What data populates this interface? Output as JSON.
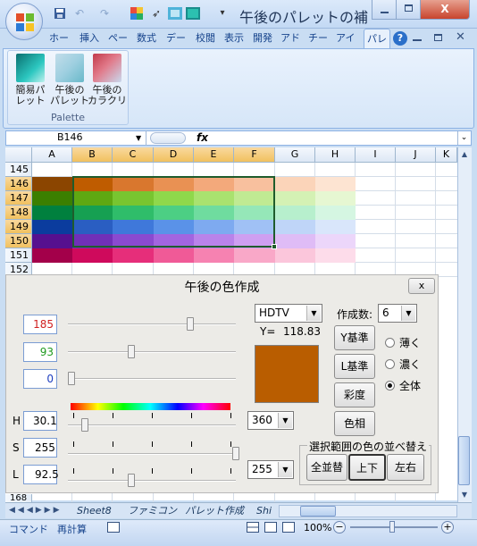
{
  "titlebar": {
    "title": "午後のパレットの補",
    "close": "X",
    "qa_icons": [
      "save-icon",
      "undo-icon",
      "redo-icon",
      "color-grid-icon",
      "pointer-icon",
      "palette-icon"
    ]
  },
  "ribbon": {
    "tabs": [
      "ホー",
      "挿入",
      "ペー",
      "数式",
      "デー",
      "校閲",
      "表示",
      "開発",
      "アド",
      "チー",
      "アイ",
      "パレ"
    ],
    "active_tab": "パレ",
    "buttons": [
      {
        "label": "簡易パレット",
        "line1": "簡易パ",
        "line2": "レット"
      },
      {
        "label": "午後のパレット",
        "line1": "午後の",
        "line2": "パレット"
      },
      {
        "label": "午後のカラクリ",
        "line1": "午後の",
        "line2": "カラクリ"
      }
    ],
    "group_label": "Palette"
  },
  "formula_bar": {
    "name_box": "B146",
    "fx": "fx",
    "value": ""
  },
  "sheet": {
    "columns": [
      "A",
      "B",
      "C",
      "D",
      "E",
      "F",
      "G",
      "H",
      "I",
      "J",
      "K"
    ],
    "selected_columns": [
      "B",
      "C",
      "D",
      "E",
      "F"
    ],
    "rows": [
      "145",
      "146",
      "147",
      "148",
      "149",
      "150",
      "151",
      "152"
    ],
    "selected_rows": [
      "146",
      "147",
      "148",
      "149",
      "150"
    ],
    "hidden_row_label": "168",
    "cell_colors": {
      "146": [
        "#8b4500",
        "#bf5c00",
        "#d9772e",
        "#e99153",
        "#f3a97b",
        "#f8c09e",
        "#fbd4b9",
        "#fde4d2"
      ],
      "147": [
        "#3b7f00",
        "#5fa812",
        "#78c530",
        "#8fd84b",
        "#a9e26f",
        "#c0ea93",
        "#d4f1b4",
        "#e6f7d2"
      ],
      "148": [
        "#00803e",
        "#16a052",
        "#2fbd6a",
        "#4ccf84",
        "#6fdc9f",
        "#95e7b8",
        "#b7efcd",
        "#d5f6e2"
      ],
      "149": [
        "#0b3c9e",
        "#2a5ec2",
        "#3f78da",
        "#5a92e8",
        "#7eaaf0",
        "#a0c1f5",
        "#bfd5f8",
        "#d9e6fb"
      ],
      "150": [
        "#56108f",
        "#7030b8",
        "#8a4ad0",
        "#a265e0",
        "#b983ea",
        "#ce9ff1",
        "#dfbcf6",
        "#ecd6fa"
      ],
      "151": [
        "#a3004a",
        "#cf0a5c",
        "#e62e7a",
        "#f05a97",
        "#f682b1",
        "#f9a8c8",
        "#fbc6db",
        "#fddcea"
      ]
    }
  },
  "sheet_tabs": [
    "Sheet8",
    "ファミコン",
    "パレット作成",
    "Shi"
  ],
  "statusbar": {
    "mode": "コマンド",
    "recalc": "再計算",
    "zoom": "100%",
    "zoom_minus": "−",
    "zoom_plus": "+"
  },
  "dialog": {
    "title": "午後の色作成",
    "close": "x",
    "rgb": {
      "r": "185",
      "g": "93",
      "b": "0",
      "r_color": "#d02020",
      "g_color": "#1f9a1f",
      "b_color": "#1f3fbf",
      "r_level": 0.7255,
      "g_level": 0.3647,
      "b_level": 0.0
    },
    "standard": "HDTV",
    "y_label": "Y=",
    "y_value": "118.83",
    "count_label": "作成数:",
    "count_value": "6",
    "swatch_color": "#b95d00",
    "buttons": {
      "y_base": "Y基準",
      "l_base": "L基準",
      "saturation": "彩度",
      "hue": "色相"
    },
    "radios": {
      "light": "薄く",
      "dark": "濃く",
      "all": "全体",
      "selected": "all"
    },
    "hsl": {
      "h_label": "H",
      "s_label": "S",
      "l_label": "L",
      "h_value": "30.16",
      "s_value": "255",
      "l_value": "92.5",
      "h_range": "360",
      "l_range": "255",
      "h_level": 0.0838,
      "s_level": 1.0,
      "l_level": 0.3627
    },
    "sort_group": {
      "label": "選択範囲の色の並べ替え",
      "all": "全並替",
      "vertical": "上下",
      "horizontal": "左右"
    }
  }
}
